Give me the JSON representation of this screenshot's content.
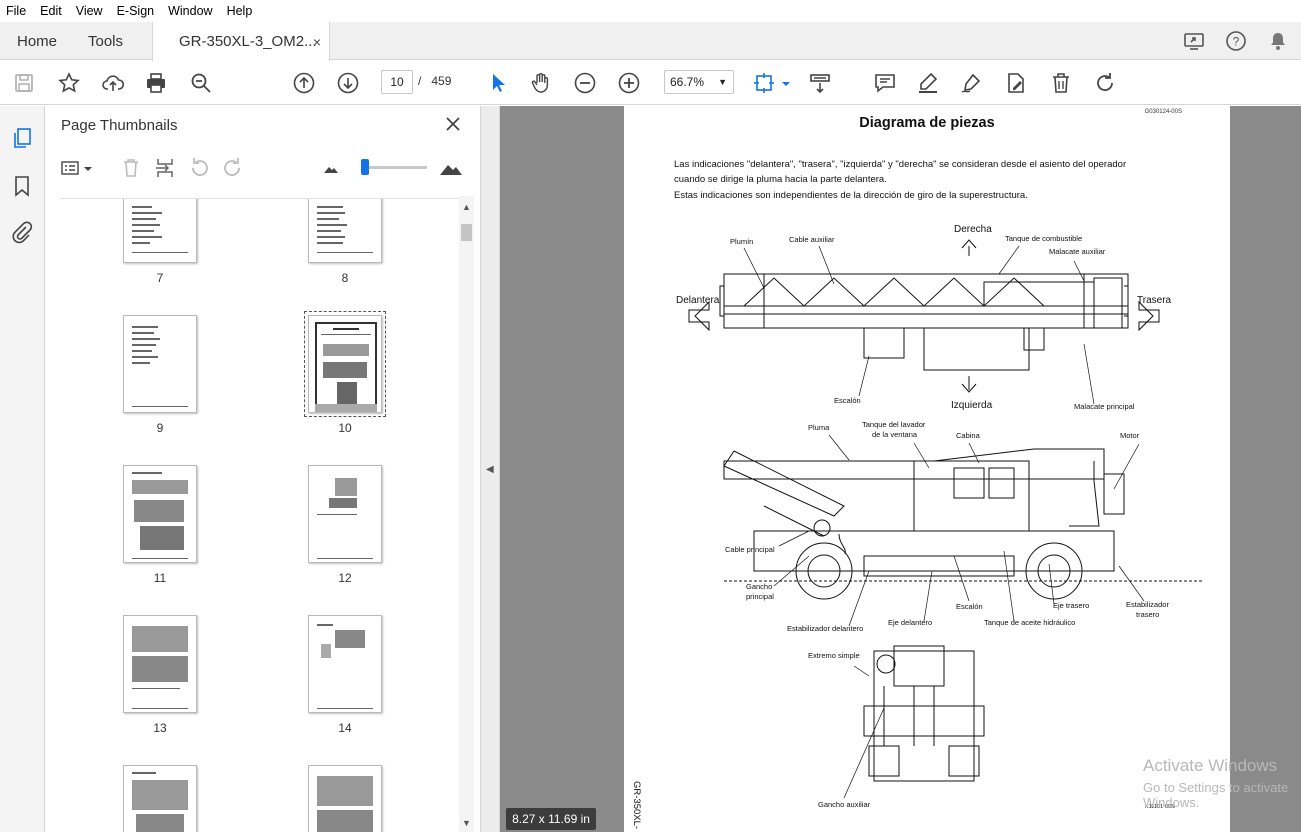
{
  "menu": [
    "File",
    "Edit",
    "View",
    "E-Sign",
    "Window",
    "Help"
  ],
  "tabs": {
    "home": "Home",
    "tools": "Tools",
    "doc": "GR-350XL-3_OM2...",
    "close": "×"
  },
  "toolbar": {
    "page_current": "10",
    "page_sep": "/",
    "page_total": "459",
    "zoom": "66.7%"
  },
  "panel": {
    "title": "Page Thumbnails",
    "close": "✕"
  },
  "thumbnails": [
    {
      "label": "7"
    },
    {
      "label": "8"
    },
    {
      "label": "9"
    },
    {
      "label": "10"
    },
    {
      "label": "11"
    },
    {
      "label": "12"
    },
    {
      "label": "13"
    },
    {
      "label": "14"
    }
  ],
  "document": {
    "code_top": "G030124-00S",
    "title": "Diagrama de piezas",
    "para1": "Las indicaciones \"delantera\", \"trasera\", \"izquierda\" y \"derecha\" se consideran desde el asiento del operador",
    "para2": "cuando se dirige la pluma hacia la parte delantera.",
    "para3": "Estas indicaciones son independientes de la dirección de giro de la superestructura.",
    "side_text": "GR-350XL-",
    "code_bottom": "K11101-00S",
    "labels": {
      "plumin": "Plumín",
      "cable_aux": "Cable auxiliar",
      "derecha": "Derecha",
      "tanque_comb": "Tanque de combustible",
      "malacate_aux": "Malacate auxiliar",
      "delantera": "Delantera",
      "trasera": "Trasera",
      "escalon1": "Escalón",
      "izquierda": "Izquierda",
      "malacate_pr": "Malacate principal",
      "pluma": "Pluma",
      "tanque_lav1": "Tanque del lavador",
      "tanque_lav2": "de la ventana",
      "cabina": "Cabina",
      "motor": "Motor",
      "cable_pr": "Cable principal",
      "gancho_pr1": "Gancho",
      "gancho_pr2": "principal",
      "estab_del": "Estabilizador delantero",
      "eje_del": "Eje delantero",
      "escalon2": "Escalón",
      "eje_tras": "Eje trasero",
      "tanque_hid": "Tanque de aceite hidráulico",
      "estab_tras1": "Estabilizador",
      "estab_tras2": "trasero",
      "extremo": "Extremo simple",
      "gancho_aux": "Gancho auxiliar"
    }
  },
  "status": {
    "page_size": "8.27 x 11.69 in"
  },
  "watermark": {
    "line1": "Activate Windows",
    "line2": "Go to Settings to activate Windows."
  }
}
